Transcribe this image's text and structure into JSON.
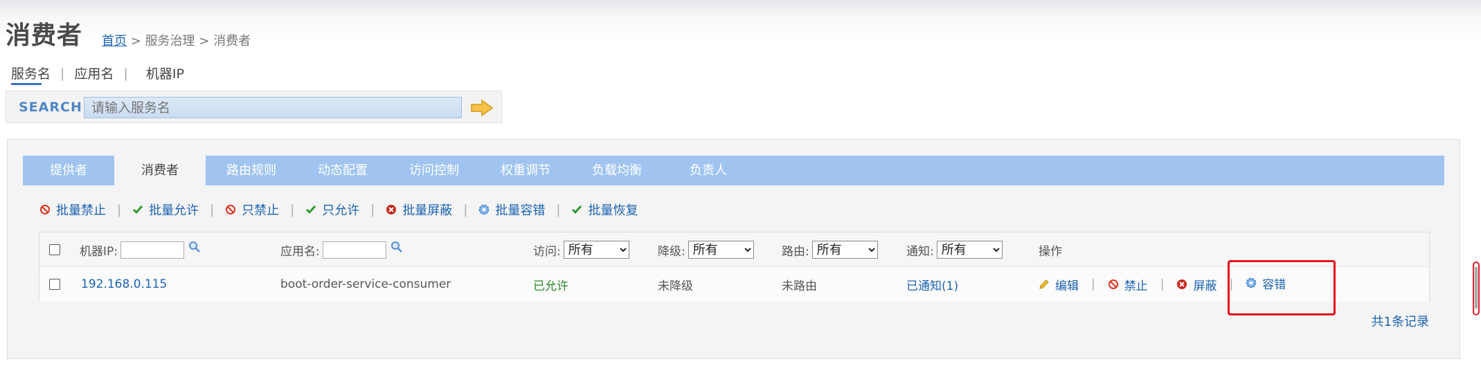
{
  "header": {
    "title": "消费者",
    "breadcrumb": {
      "home": "首页",
      "sep1": ">",
      "section": "服务治理",
      "sep2": ">",
      "current": "消费者"
    }
  },
  "search_types": [
    "服务名",
    "应用名",
    "机器IP"
  ],
  "search": {
    "label": "SEARCH",
    "placeholder": "请输入服务名"
  },
  "tabs": [
    "提供者",
    "消费者",
    "路由规则",
    "动态配置",
    "访问控制",
    "权重调节",
    "负载均衡",
    "负责人"
  ],
  "active_tab": "消费者",
  "toolbar": {
    "batch_forbid": "批量禁止",
    "batch_allow": "批量允许",
    "only_forbid": "只禁止",
    "only_allow": "只允许",
    "batch_shield": "批量屏蔽",
    "batch_tolerance": "批量容错",
    "batch_recover": "批量恢复"
  },
  "table": {
    "headers": {
      "ip": "机器IP:",
      "app": "应用名:",
      "access": "访问:",
      "degrade": "降级:",
      "route": "路由:",
      "notify": "通知:",
      "ops": "操作"
    },
    "filter_value": "所有",
    "rows": [
      {
        "ip": "192.168.0.115",
        "app": "boot-order-service-consumer",
        "access": "已允许",
        "degrade": "未降级",
        "route": "未路由",
        "notify": "已通知(1)",
        "ops": {
          "edit": "编辑",
          "forbid": "禁止",
          "shield": "屏蔽",
          "tolerance": "容错"
        }
      }
    ],
    "total": "共1条记录"
  },
  "colors": {
    "tab_bar": "#a0c4ef",
    "link": "#1c63b0",
    "allowed": "#2a8a2a",
    "highlight": "#e4121b"
  }
}
